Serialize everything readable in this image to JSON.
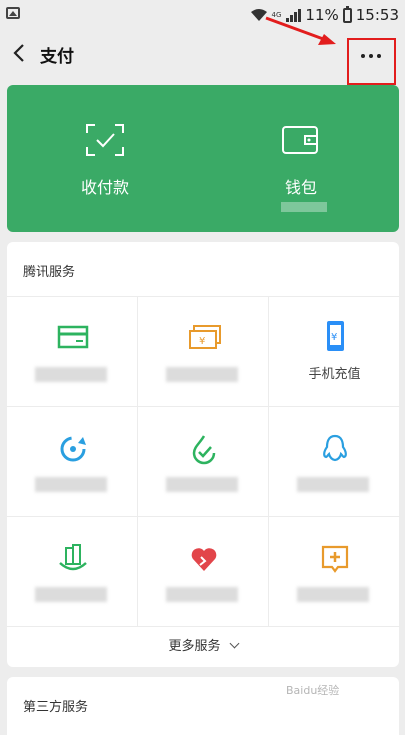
{
  "status_bar": {
    "network": "4G",
    "battery": "11%",
    "time": "15:53"
  },
  "header": {
    "title": "支付",
    "back_icon": "chevron-left-icon",
    "more_icon": "more-horizontal-icon"
  },
  "pay_card": {
    "background": "#3aaa66",
    "items": [
      {
        "label": "收付款",
        "icon": "scan-check-icon"
      },
      {
        "label": "钱包",
        "icon": "wallet-icon"
      }
    ]
  },
  "tencent_services": {
    "title": "腾讯服务",
    "cells": [
      {
        "icon": "card-icon",
        "color": "#2db35f",
        "label": ""
      },
      {
        "icon": "money-stack-icon",
        "color": "#e89a2c",
        "label": ""
      },
      {
        "icon": "phone-recharge-icon",
        "color": "#2a8ff7",
        "label": "手机充值"
      },
      {
        "icon": "refresh-circle-icon",
        "color": "#2a9fe0",
        "label": ""
      },
      {
        "icon": "check-drop-icon",
        "color": "#2db35f",
        "label": ""
      },
      {
        "icon": "qq-penguin-icon",
        "color": "#2a9fe0",
        "label": ""
      },
      {
        "icon": "city-service-icon",
        "color": "#2db35f",
        "label": ""
      },
      {
        "icon": "charity-heart-icon",
        "color": "#e2454a",
        "label": ""
      },
      {
        "icon": "medical-cross-icon",
        "color": "#e89a2c",
        "label": ""
      }
    ],
    "more_label": "更多服务"
  },
  "third_party": {
    "title": "第三方服务"
  },
  "annotation_color": "#e21d1d",
  "watermark": "Baidu经验"
}
